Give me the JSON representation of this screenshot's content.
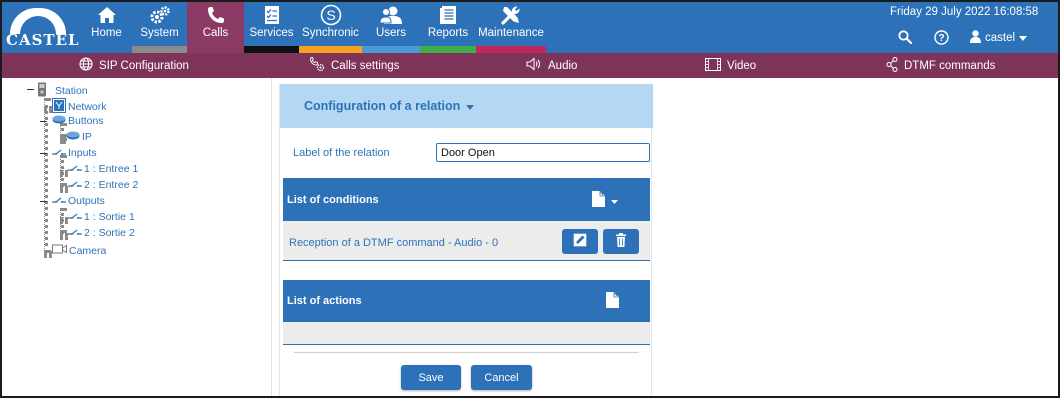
{
  "app": {
    "logo_text": "CASTEL",
    "datetime": "Friday 29 July 2022 16:08:58",
    "user": "castel"
  },
  "nav": [
    {
      "id": "home",
      "label": "Home",
      "icon": "home-icon",
      "stripe": ""
    },
    {
      "id": "system",
      "label": "System",
      "icon": "gears-icon",
      "stripe": "#8b8b8b"
    },
    {
      "id": "calls",
      "label": "Calls",
      "icon": "phone-icon",
      "stripe": "",
      "active": true
    },
    {
      "id": "services",
      "label": "Services",
      "icon": "checklist-icon",
      "stripe": "#111111"
    },
    {
      "id": "synchronic",
      "label": "Synchronic",
      "icon": "synchronic-s-icon",
      "stripe": "#f5a020"
    },
    {
      "id": "users",
      "label": "Users",
      "icon": "users-icon",
      "stripe": "#4a9ad8"
    },
    {
      "id": "reports",
      "label": "Reports",
      "icon": "report-icon",
      "stripe": "#3fae49"
    },
    {
      "id": "maintenance",
      "label": "Maintenance",
      "icon": "tools-icon",
      "stripe": "#c1275a"
    }
  ],
  "subnav": [
    {
      "label": "SIP Configuration",
      "icon": "globe-icon"
    },
    {
      "label": "Calls settings",
      "icon": "phone-settings-icon"
    },
    {
      "label": "Audio",
      "icon": "speaker-icon"
    },
    {
      "label": "Video",
      "icon": "film-icon"
    },
    {
      "label": "DTMF commands",
      "icon": "share-nodes-icon"
    }
  ],
  "tree": {
    "station": "Station",
    "network": "Network",
    "buttons": "Buttons",
    "ip": "IP",
    "inputs": "Inputs",
    "input1": "1 : Entree 1",
    "input2": "2 : Entree 2",
    "outputs": "Outputs",
    "output1": "1 : Sortie 1",
    "output2": "2 : Sortie 2",
    "camera": "Camera"
  },
  "panel": {
    "title": "Configuration of a relation",
    "label_field": {
      "label": "Label of the relation",
      "value": "Door Open"
    },
    "conditions": {
      "title": "List of conditions",
      "items": [
        "Reception of a DTMF command - Audio - 0"
      ]
    },
    "actions": {
      "title": "List of actions"
    },
    "save_label": "Save",
    "cancel_label": "Cancel"
  }
}
